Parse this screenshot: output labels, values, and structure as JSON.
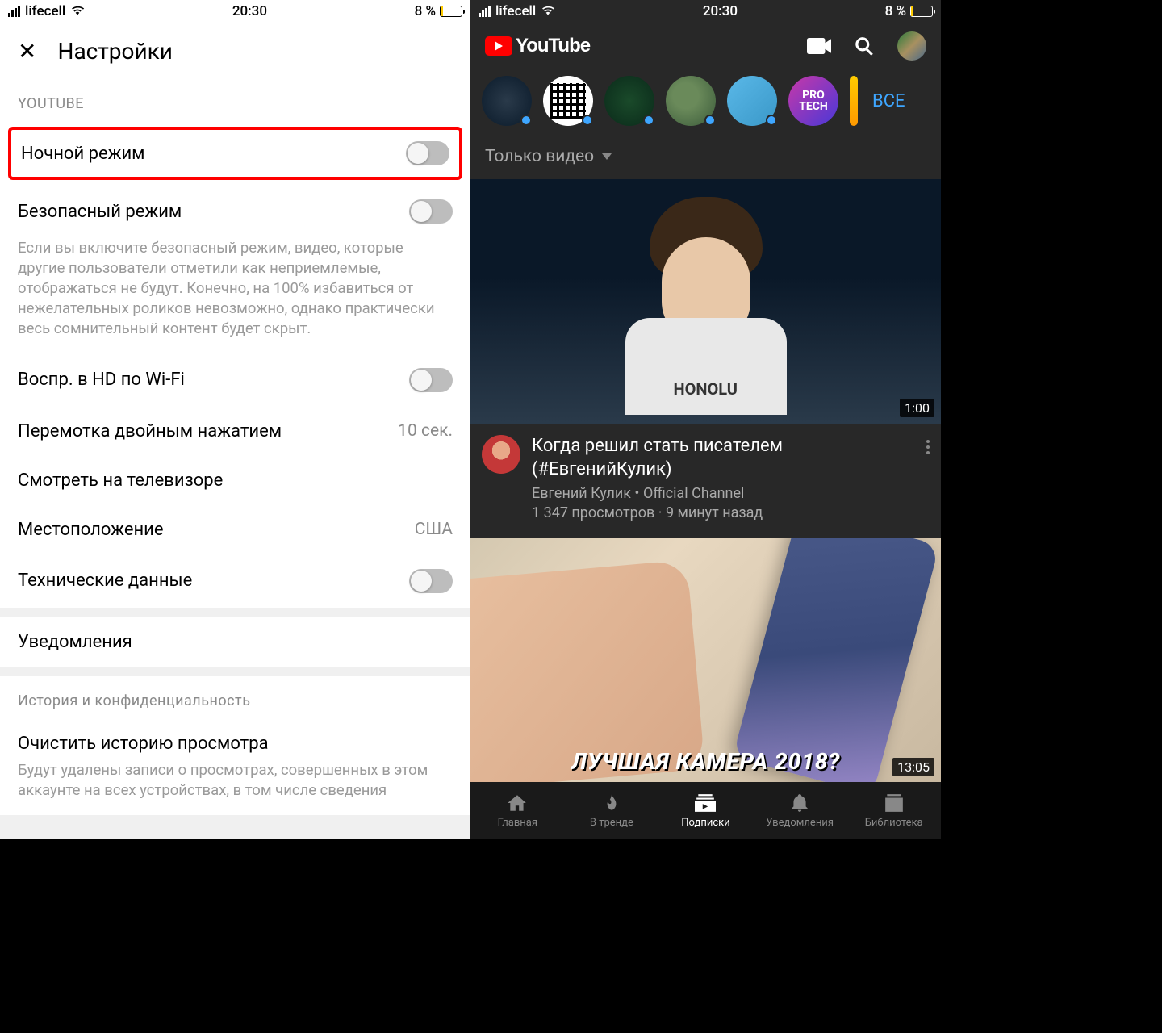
{
  "status": {
    "carrier": "lifecell",
    "time": "20:30",
    "battery": "8 %"
  },
  "left": {
    "title": "Настройки",
    "section1": "YOUTUBE",
    "nightMode": "Ночной режим",
    "safeMode": "Безопасный режим",
    "safeModeDesc": "Если вы включите безопасный режим, видео, которые другие пользователи отметили как неприемлемые, отображаться не будут. Конечно, на 100% избавиться от нежелательных роликов невозможно, однако практически весь сомнительный контент будет скрыт.",
    "hdWifi": "Воспр. в HD по Wi-Fi",
    "doubleTap": "Перемотка двойным нажатием",
    "doubleTapVal": "10 сек.",
    "tv": "Смотреть на телевизоре",
    "location": "Местоположение",
    "locationVal": "США",
    "techData": "Технические данные",
    "notifications": "Уведомления",
    "section2": "История и конфиденциальность",
    "clearHistory": "Очистить историю просмотра",
    "clearHistoryDesc": "Будут удалены записи о просмотрах, совершенных в этом аккаунте на всех устройствах, в том числе сведения"
  },
  "right": {
    "logoText": "YouTube",
    "allBtn": "ВСЕ",
    "filter": "Только видео",
    "ch6text": "PRO\nTECH",
    "video1": {
      "duration": "1:00",
      "title": "Когда решил стать писателем (#ЕвгенийКулик)",
      "channel": "Евгений Кулик • Official Channel",
      "meta": "1 347 просмотров · 9 минут назад",
      "shirt": "HONOLU"
    },
    "video2": {
      "duration": "13:05",
      "banner": "ЛУЧШАЯ КАМЕРА 2018?"
    },
    "nav": {
      "home": "Главная",
      "trending": "В тренде",
      "subs": "Подписки",
      "notif": "Уведомления",
      "library": "Библиотека"
    }
  }
}
